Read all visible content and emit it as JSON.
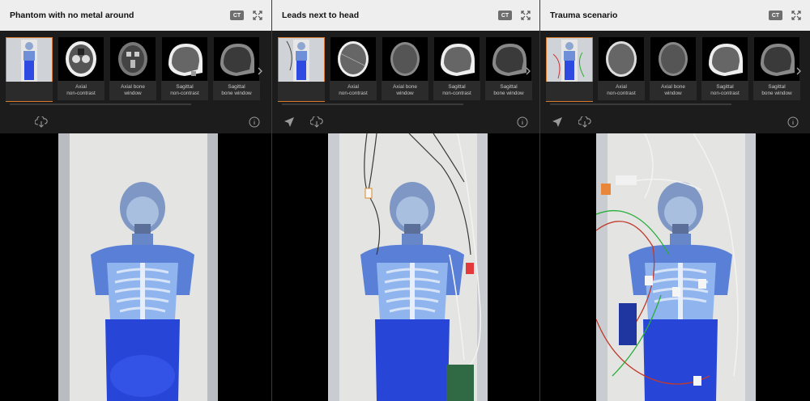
{
  "modality_badge": "CT",
  "panels": [
    {
      "title": "Phantom with no metal around",
      "thumbnails": [
        {
          "label_line1": "",
          "label_line2": ""
        },
        {
          "label_line1": "Axial",
          "label_line2": "non-contrast"
        },
        {
          "label_line1": "Axial bone",
          "label_line2": "window"
        },
        {
          "label_line1": "Sagittal",
          "label_line2": "non-contrast"
        },
        {
          "label_line1": "Sagittal",
          "label_line2": "bone window"
        }
      ],
      "tools": [
        "download-icon",
        "info-icon"
      ]
    },
    {
      "title": "Leads next to head",
      "thumbnails": [
        {
          "label_line1": "",
          "label_line2": ""
        },
        {
          "label_line1": "Axial",
          "label_line2": "non-contrast"
        },
        {
          "label_line1": "Axial bone",
          "label_line2": "window"
        },
        {
          "label_line1": "Sagittal",
          "label_line2": "non-contrast"
        },
        {
          "label_line1": "Sagittal",
          "label_line2": "bone window"
        }
      ],
      "tools": [
        "locate-icon",
        "download-icon",
        "info-icon"
      ]
    },
    {
      "title": "Trauma scenario",
      "thumbnails": [
        {
          "label_line1": "",
          "label_line2": ""
        },
        {
          "label_line1": "Axial",
          "label_line2": "non-contrast"
        },
        {
          "label_line1": "Axial bone",
          "label_line2": "window"
        },
        {
          "label_line1": "Sagittal",
          "label_line2": "non-contrast"
        },
        {
          "label_line1": "Sagittal",
          "label_line2": "bone window"
        }
      ],
      "tools": [
        "locate-icon",
        "download-icon",
        "info-icon"
      ]
    }
  ],
  "colors": {
    "selection": "#d87a2c",
    "header_bg": "#eeeeee",
    "panel_bg": "#1c1c1c",
    "phantom_blue": "#2f4fd0"
  }
}
